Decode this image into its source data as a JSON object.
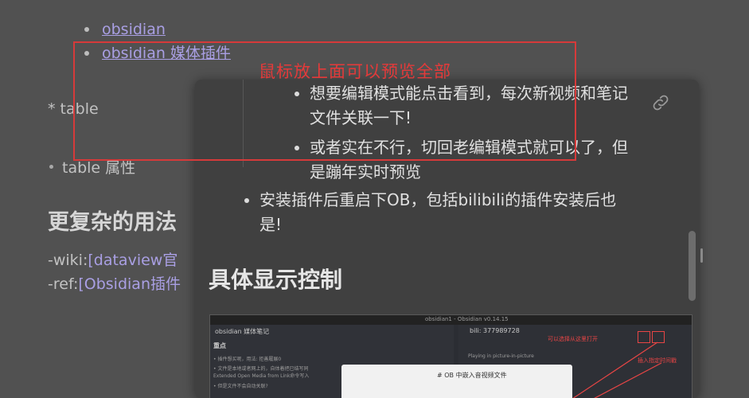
{
  "background_note": {
    "list_items": [
      {
        "label": "obsidian"
      },
      {
        "label": "obsidian 媒体插件"
      }
    ],
    "table_line": "* table",
    "table_attr_line": "table 属性",
    "heading": "更复杂的用法",
    "wiki_prefix": "-wiki:",
    "wiki_link": "[dataview官",
    "ref_prefix": "-ref:",
    "ref_link": "[Obsidian插件"
  },
  "annotation": {
    "note": "鼠标放上面可以预览全部",
    "color": "#d63a3a"
  },
  "hover_preview": {
    "sub_items": [
      {
        "line1": "想要编辑模式能点击看到，每次新视频和笔记",
        "line2": "文件关联一下!"
      },
      {
        "line1": "或者实在不行，切回老编辑模式就可以了，但",
        "line2": "是蹦年实时预览"
      }
    ],
    "main_item": {
      "line1": "安装插件后重启下OB，包括bilibili的插件安装后也",
      "line2": "是!"
    },
    "heading": "具体显示控制",
    "link_icon": "link-icon",
    "embedded_screenshot": {
      "window_title": "obsidian1 - Obsidian v0.14.15",
      "left_tab": "obsidian 媒体笔记",
      "left_heading": "重点",
      "left_line1": "• 插件想买呢，用法: 拒善履展0",
      "left_line2": "• 文件是本地或者网上的，自体着把已结写同",
      "left_line3": "  Extended Open Media from Link命令写入",
      "left_line4": "• 但是文件不会自动关联?",
      "right_tab": "bili: 377989728",
      "right_status": "Playing in picture-in-picture",
      "card_title": "# OB 中嵌入音视频文件",
      "red_label1": "可以选择从这里打开",
      "red_label2": "插入指定时间戳"
    }
  },
  "colors": {
    "page_bg": "#515151",
    "popover_bg": "#404040",
    "link": "#a99fe3"
  }
}
